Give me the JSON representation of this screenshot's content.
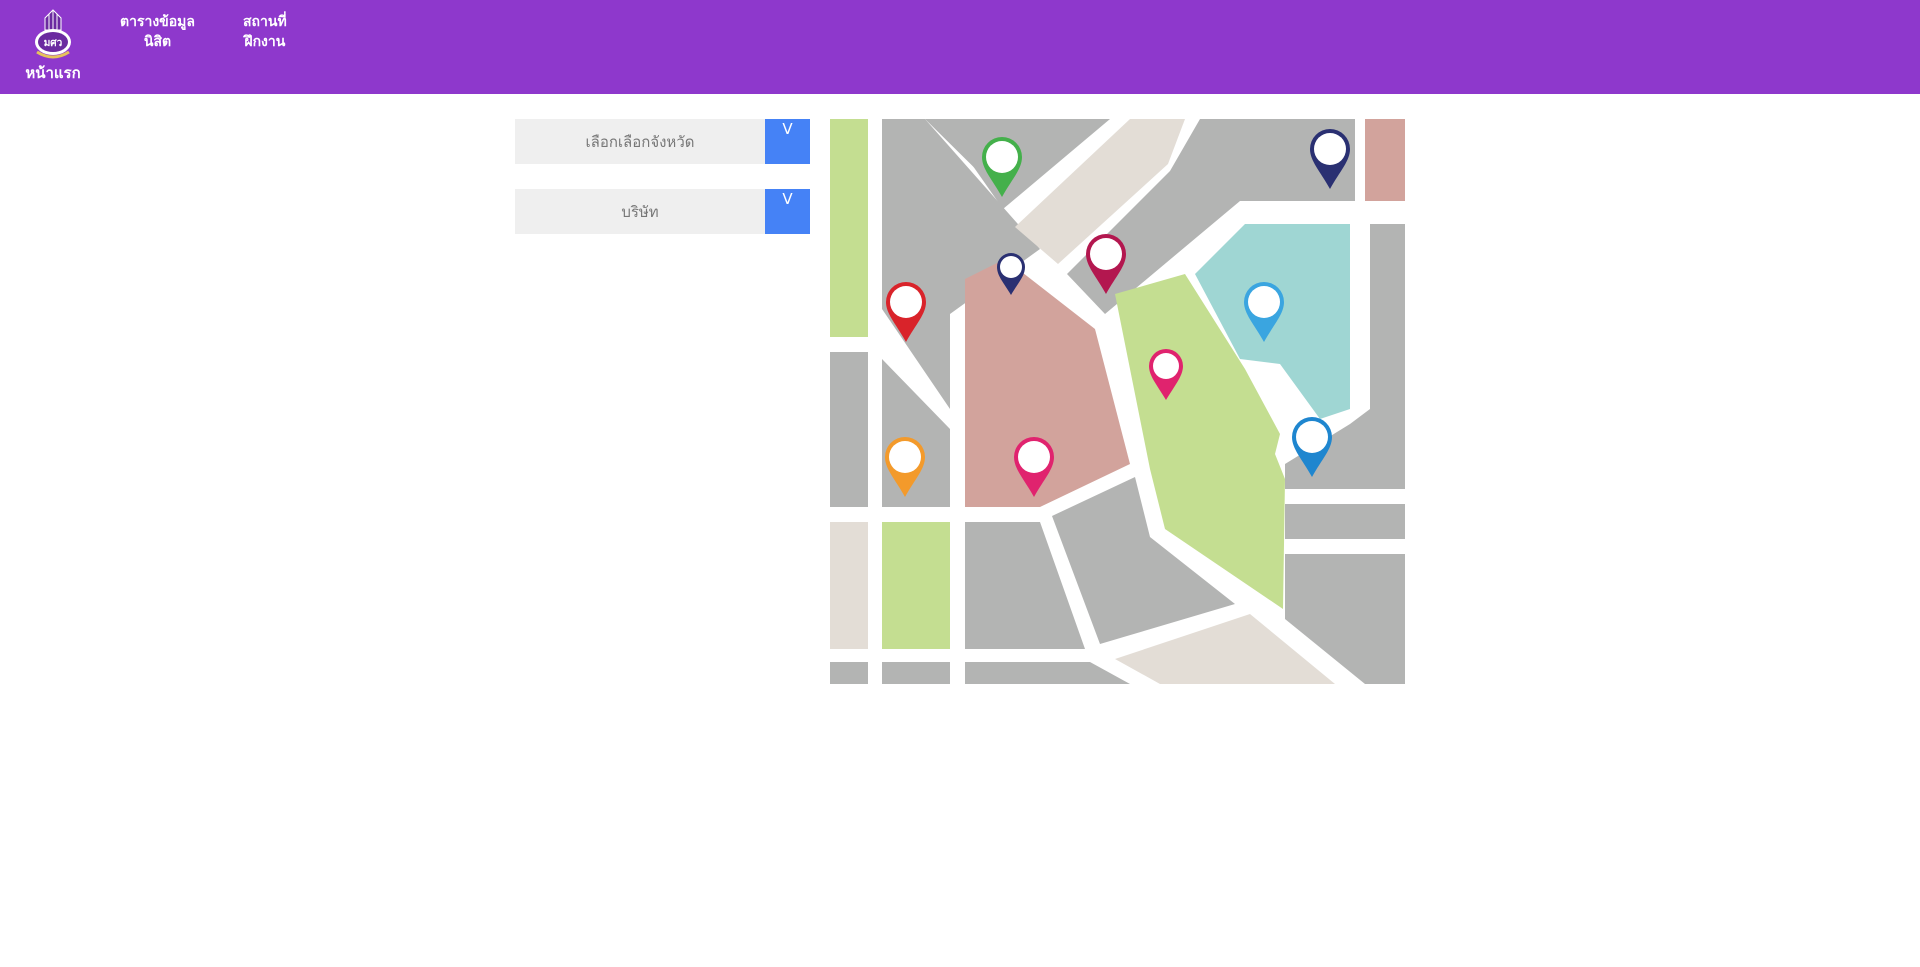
{
  "nav": {
    "home_label": "หน้าแรก",
    "items": [
      {
        "line1": "ตารางข้อมูล",
        "line2": "นิสิต"
      },
      {
        "line1": "สถานที่",
        "line2": "ฝึกงาน"
      }
    ]
  },
  "filters": {
    "province": {
      "value": "เลือกเลือกจังหวัด",
      "arrow": "V"
    },
    "company": {
      "value": "บริษัท",
      "arrow": "V"
    }
  },
  "colors": {
    "topbar": "#8e38cc",
    "dropdown_button": "#4582f6",
    "field_bg": "#efefef"
  },
  "map": {
    "icon": "map-illustration",
    "pins": [
      "green",
      "navy",
      "red",
      "crimson",
      "navy-small",
      "sky-blue",
      "pink",
      "orange",
      "pink",
      "blue"
    ]
  }
}
